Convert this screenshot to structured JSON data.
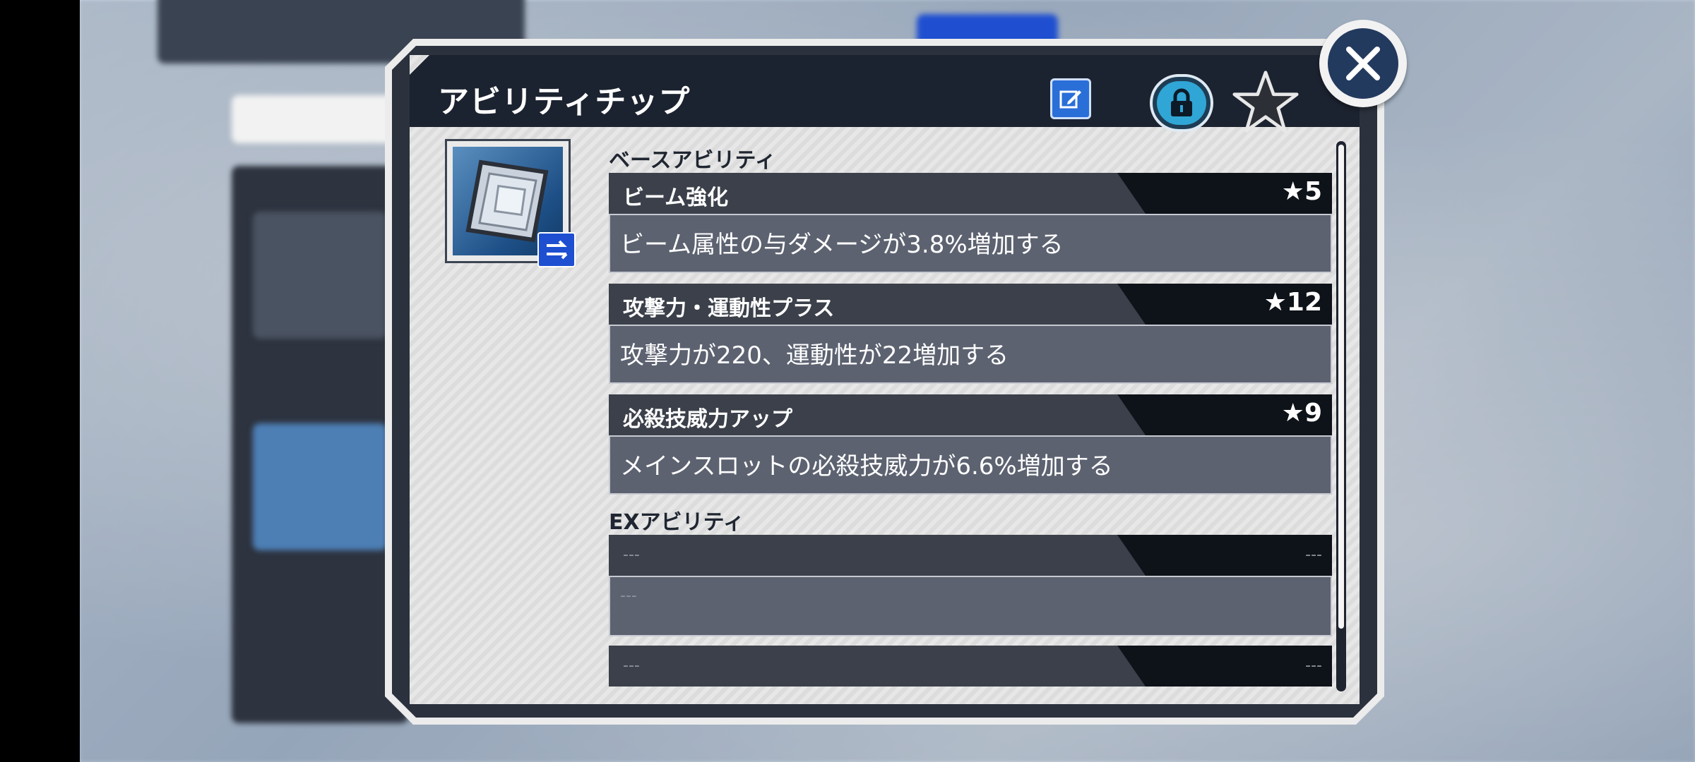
{
  "modal": {
    "title": "アビリティチップ",
    "close_icon": "close-x-icon",
    "edit_icon": "edit-pencil-icon",
    "lock_icon": "lock-icon",
    "favorite_icon": "star-icon",
    "swap_icon": "swap-arrows-icon"
  },
  "base_ability_label": "ベースアビリティ",
  "base_abilities": [
    {
      "name": "ビーム強化",
      "rank": "★5",
      "description": "ビーム属性の与ダメージが3.8%増加する"
    },
    {
      "name": "攻撃力・運動性プラス",
      "rank": "★12",
      "description": "攻撃力が220、運動性が22増加する"
    },
    {
      "name": "必殺技威力アップ",
      "rank": "★9",
      "description": "メインスロットの必殺技威力が6.6%増加する"
    }
  ],
  "ex_ability_label": "EXアビリティ",
  "ex_abilities": [
    {
      "name": "---",
      "rank": "---",
      "description": "---"
    },
    {
      "name": "---",
      "rank": "---"
    }
  ],
  "colors": {
    "title_bar": "#1c2330",
    "card_head": "#0e1219",
    "card_body": "#5c6270",
    "accent_blue": "#2a6fd8",
    "close_bg": "#233a5f"
  }
}
